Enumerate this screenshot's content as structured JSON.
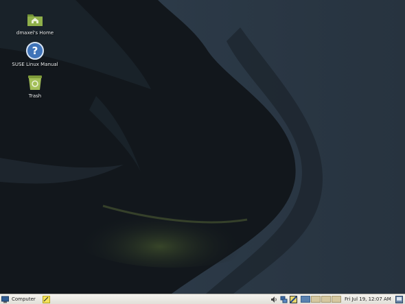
{
  "desktop": {
    "icons": [
      {
        "label": "dmaxel's Home",
        "icon": "home-folder-icon"
      },
      {
        "label": "SUSE Linux Manual",
        "icon": "help-icon"
      },
      {
        "label": "Trash",
        "icon": "trash-icon"
      }
    ]
  },
  "panel": {
    "computer_label": "Computer",
    "clock": "Fri Jul 19, 12:07 AM",
    "workspaces_total": 4,
    "workspace_active": 1,
    "tray_icons": [
      "volume-icon",
      "network-icon",
      "tray-app-icon"
    ]
  },
  "colors": {
    "desktop_bg": "#141a20",
    "panel_bg": "#e9e7e1",
    "workspace_active": "#5a82b0",
    "workspace_inactive": "#d4c7a0",
    "folder_green": "#7ea13c"
  }
}
